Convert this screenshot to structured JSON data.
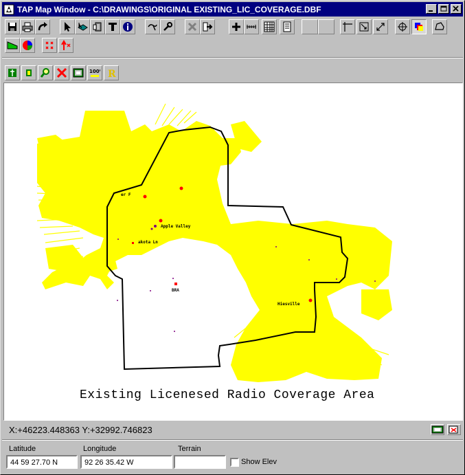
{
  "window": {
    "title": "TAP Map Window - C:\\DRAWINGS\\ORIGINAL EXISTING_LIC_COVERAGE.DBF",
    "controls": [
      "minimize",
      "maximize",
      "close"
    ]
  },
  "toolbar_row1": [
    "save-icon",
    "print-icon",
    "redo-icon",
    "pointer-icon",
    "select-layer-icon",
    "fill-icon",
    "text-icon",
    "info-icon",
    "lasso-icon",
    "wrench-icon",
    "delete-icon",
    "import-icon",
    "add-icon",
    "ruler-icon",
    "grid-icon",
    "notes-icon",
    "blank",
    "blank",
    "crosshair-icon",
    "resize-icon",
    "diagonal-icon",
    "pan-icon",
    "layers-icon",
    "polygon-icon"
  ],
  "toolbar_row2": [
    "area-icon",
    "globe-icon",
    "stations-icon",
    "arrow-up-icon"
  ],
  "toolbar_row3": [
    "site-icon",
    "marker-icon",
    "zoom-icon",
    "cancel-icon",
    "map-icon",
    "zoom-100-icon",
    "radius-icon"
  ],
  "map": {
    "labels": {
      "apple_valley": "Apple Valley",
      "akota": "akota Ln",
      "bra": "BRA",
      "hiesville": "Hiesville",
      "tr": "er F"
    },
    "caption": "Existing Licenesed Radio Coverage Area",
    "coverage_color": "#ffff00",
    "site_color": "#ff0000",
    "boundary_color": "#000000"
  },
  "status": {
    "coords": "X:+46223.448363 Y:+32992.746823"
  },
  "fields": {
    "latitude_label": "Latitude",
    "latitude_value": "44 59 27.70 N",
    "longitude_label": "Longitude",
    "longitude_value": "92 26 35.42 W",
    "terrain_label": "Terrain",
    "terrain_value": "",
    "show_elev_label": "Show Elev",
    "show_elev_checked": false
  }
}
